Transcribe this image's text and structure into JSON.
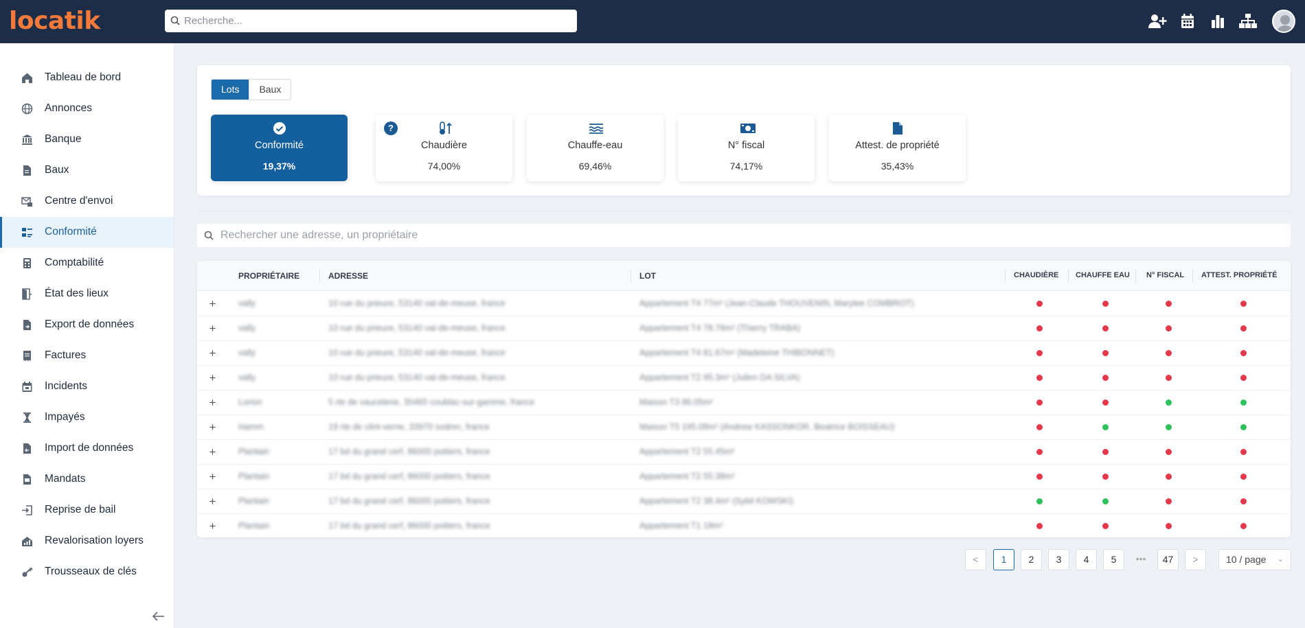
{
  "app": {
    "logo": "locatik"
  },
  "search": {
    "placeholder": "Recherche..."
  },
  "sidebar": {
    "items": [
      {
        "label": "Tableau de bord",
        "icon": "home-icon"
      },
      {
        "label": "Annonces",
        "icon": "globe-icon"
      },
      {
        "label": "Banque",
        "icon": "bank-icon"
      },
      {
        "label": "Baux",
        "icon": "document-icon"
      },
      {
        "label": "Centre d'envoi",
        "icon": "send-center-icon"
      },
      {
        "label": "Conformité",
        "icon": "compliance-icon",
        "active": true
      },
      {
        "label": "Comptabilité",
        "icon": "calculator-icon"
      },
      {
        "label": "État des lieux",
        "icon": "door-icon"
      },
      {
        "label": "Export de données",
        "icon": "export-icon"
      },
      {
        "label": "Factures",
        "icon": "invoice-icon"
      },
      {
        "label": "Incidents",
        "icon": "calendar-alert-icon"
      },
      {
        "label": "Impayés",
        "icon": "hourglass-icon"
      },
      {
        "label": "Import de données",
        "icon": "import-icon"
      },
      {
        "label": "Mandats",
        "icon": "folder-icon"
      },
      {
        "label": "Reprise de bail",
        "icon": "login-icon"
      },
      {
        "label": "Revalorisation loyers",
        "icon": "house-chart-icon"
      },
      {
        "label": "Trousseaux de clés",
        "icon": "key-icon"
      }
    ]
  },
  "tabs": {
    "lots": "Lots",
    "baux": "Baux"
  },
  "stats": [
    {
      "label": "Conformité",
      "value": "19,37%",
      "icon": "check-circle-icon",
      "active": true
    },
    {
      "label": "Chaudière",
      "value": "74,00%",
      "icon": "thermometer-icon"
    },
    {
      "label": "Chauffe-eau",
      "value": "69,46%",
      "icon": "water-heater-icon"
    },
    {
      "label": "N° fiscal",
      "value": "74,17%",
      "icon": "money-icon"
    },
    {
      "label": "Attest. de propriété",
      "value": "35,43%",
      "icon": "file-icon"
    }
  ],
  "help_badge": "?",
  "address_search": {
    "placeholder": "Rechercher une adresse, un propriétaire"
  },
  "table": {
    "headers": {
      "owner": "PROPRIÉTAIRE",
      "address": "ADRESSE",
      "lot": "LOT",
      "boiler": "CHAUDIÈRE",
      "water_heater": "CHAUFFE EAU",
      "tax_number": "N° FISCAL",
      "ownership": "ATTEST. PROPRIÉTÉ"
    },
    "rows": [
      {
        "owner": "vally",
        "address": "10 rue du prieure, 53140 val-de-meuse, france",
        "lot": "Appartement T4 77m² (Jean-Claude THOUVENIN, Marylee COMBROT)",
        "status": [
          "red",
          "red",
          "red",
          "red"
        ]
      },
      {
        "owner": "vally",
        "address": "10 rue du prieure, 53140 val-de-meuse, france",
        "lot": "Appartement T4 78.76m² (Thierry TRABA)",
        "status": [
          "red",
          "red",
          "red",
          "red"
        ]
      },
      {
        "owner": "vally",
        "address": "10 rue du prieure, 53140 val-de-meuse, france",
        "lot": "Appartement T4 81.67m² (Madeleine THIBONNET)",
        "status": [
          "red",
          "red",
          "red",
          "red"
        ]
      },
      {
        "owner": "vally",
        "address": "10 rue du prieure, 53140 val-de-meuse, france",
        "lot": "Appartement T2 95.3m² (Julien DA SILVA)",
        "status": [
          "red",
          "red",
          "red",
          "red"
        ]
      },
      {
        "owner": "Lorion",
        "address": "5 rte de vaucelerie, 35465 coublac-sur-gamme, france",
        "lot": "Maison T3 86.05m²",
        "status": [
          "red",
          "red",
          "green",
          "green"
        ]
      },
      {
        "owner": "Hamm",
        "address": "19 rte de clint-verne, 33970 sodrec, france",
        "lot": "Maison T5 195.08m² (Andrew KASSONKOR, Beatrice BOISSEAU)",
        "status": [
          "red",
          "green",
          "green",
          "green"
        ]
      },
      {
        "owner": "Plantain",
        "address": "17 bd du grand cerf, 86000 poitiers, france",
        "lot": "Appartement T2 55.45m²",
        "status": [
          "red",
          "red",
          "red",
          "red"
        ]
      },
      {
        "owner": "Plantain",
        "address": "17 bd du grand cerf, 86000 poitiers, france",
        "lot": "Appartement T2 55.38m²",
        "status": [
          "red",
          "red",
          "red",
          "red"
        ]
      },
      {
        "owner": "Plantain",
        "address": "17 bd du grand cerf, 86000 poitiers, france",
        "lot": "Appartement T2 38.4m² (Sybil KOWSKI)",
        "status": [
          "green",
          "green",
          "red",
          "red"
        ]
      },
      {
        "owner": "Plantain",
        "address": "17 bd du grand cerf, 86000 poitiers, france",
        "lot": "Appartement T1 18m²",
        "status": [
          "red",
          "red",
          "red",
          "red"
        ]
      }
    ]
  },
  "pagination": {
    "prev": "<",
    "pages": [
      "1",
      "2",
      "3",
      "4",
      "5"
    ],
    "ellipsis": "•••",
    "last": "47",
    "next": ">",
    "current": "1",
    "page_size": "10 / page"
  },
  "colors": {
    "topbar": "#1d2d47",
    "logo": "#f47a3b",
    "accent": "#1b6aaa",
    "red": "#e6384b",
    "green": "#2fc25b"
  }
}
